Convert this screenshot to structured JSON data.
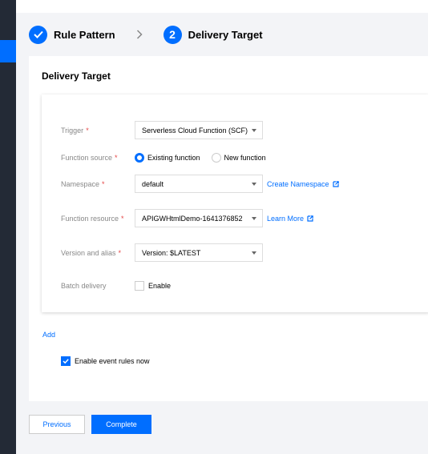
{
  "steps": [
    {
      "label": "Rule Pattern",
      "state": "done"
    },
    {
      "number": "2",
      "label": "Delivery Target",
      "state": "current"
    }
  ],
  "panel": {
    "title": "Delivery Target"
  },
  "form": {
    "trigger": {
      "label": "Trigger",
      "value": "Serverless Cloud Function (SCF)"
    },
    "function_source": {
      "label": "Function source",
      "options": [
        "Existing function",
        "New function"
      ],
      "selected": "Existing function"
    },
    "namespace": {
      "label": "Namespace",
      "value": "default",
      "link": "Create Namespace"
    },
    "function_resource": {
      "label": "Function resource",
      "value": "APIGWHtmlDemo-1641376852",
      "link": "Learn More"
    },
    "version_alias": {
      "label": "Version and alias",
      "value": "Version: $LATEST"
    },
    "batch_delivery": {
      "label": "Batch delivery",
      "checkbox_label": "Enable",
      "checked": false
    }
  },
  "add_link": "Add",
  "enable_now": {
    "label": "Enable event rules now",
    "checked": true
  },
  "buttons": {
    "previous": "Previous",
    "complete": "Complete"
  },
  "colors": {
    "accent": "#006eff",
    "sidebar": "#232a36",
    "required": "#e54545"
  }
}
